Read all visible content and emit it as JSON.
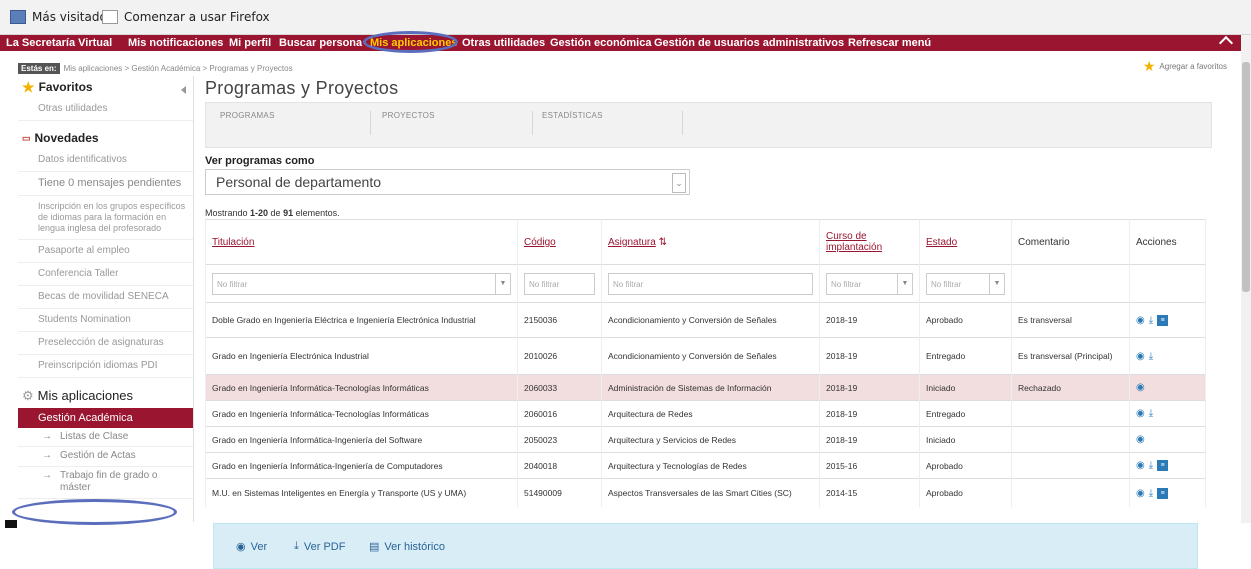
{
  "bookmarks": {
    "item1": "Más visitados",
    "item2": "Comenzar a usar Firefox"
  },
  "nav": {
    "items": [
      "La Secretaría Virtual",
      "Mis notificaciones",
      "Mi perfil",
      "Buscar persona",
      "Mis aplicaciones",
      "Otras utilidades",
      "Gestión económica",
      "Gestión de usuarios administrativos",
      "Refrescar menú"
    ],
    "active": "Mis aplicaciones"
  },
  "breadcrumb": {
    "label": "Estás en:",
    "path": "Mis aplicaciones > Gestión Académica > Programas y Proyectos"
  },
  "favorite_link": "Agregar a favoritos",
  "sidebar": {
    "favoritos_title": "Favoritos",
    "favoritos": [
      "Otras utilidades"
    ],
    "novedades_title": "Novedades",
    "novedades": [
      "Datos identificativos",
      "Tiene 0 mensajes pendientes",
      "Inscripción en los grupos específicos de idiomas para la formación en lengua inglesa del profesorado",
      "Pasaporte al empleo",
      "Conferencia Taller",
      "Becas de movilidad SENECA",
      "Students Nomination",
      "Preselección de asignaturas",
      "Preinscripción idiomas PDI"
    ],
    "apps_title": "Mis aplicaciones",
    "active_app": "Gestión Académica",
    "subitems": [
      "Listas de Clase",
      "Gestión de Actas",
      "Trabajo fin de grado o máster"
    ]
  },
  "page_title": "Programas y Proyectos",
  "tabs": [
    "PROGRAMAS",
    "PROYECTOS",
    "ESTADÍSTICAS"
  ],
  "view_as": {
    "label": "Ver programas como",
    "value": "Personal de departamento"
  },
  "showing": {
    "prefix": "Mostrando ",
    "range": "1-20",
    "middle": " de ",
    "total": "91",
    "suffix": " elementos."
  },
  "table": {
    "headers": {
      "titulacion": "Titulación",
      "codigo": "Código",
      "asignatura": "Asignatura",
      "curso": "Curso de implantación",
      "estado": "Estado",
      "comentario": "Comentario",
      "acciones": "Acciones"
    },
    "filter_placeholder": "No filtrar",
    "rows": [
      {
        "titulacion": "Doble Grado en Ingeniería Eléctrica e Ingeniería Electrónica Industrial",
        "codigo": "2150036",
        "asignatura": "Acondicionamiento y Conversión de Señales",
        "curso": "2018-19",
        "estado": "Aprobado",
        "comentario": "Es transversal",
        "acciones": [
          "view",
          "download",
          "history"
        ]
      },
      {
        "titulacion": "Grado en Ingeniería Electrónica Industrial",
        "codigo": "2010026",
        "asignatura": "Acondicionamiento y Conversión de Señales",
        "curso": "2018-19",
        "estado": "Entregado",
        "comentario": "Es transversal (Principal)",
        "acciones": [
          "view",
          "download"
        ]
      },
      {
        "titulacion": "Grado en Ingeniería Informática-Tecnologías Informáticas",
        "codigo": "2060033",
        "asignatura": "Administración de Sistemas de Información",
        "curso": "2018-19",
        "estado": "Iniciado",
        "comentario": "Rechazado",
        "acciones": [
          "view"
        ],
        "highlight": true
      },
      {
        "titulacion": "Grado en Ingeniería Informática-Tecnologías Informáticas",
        "codigo": "2060016",
        "asignatura": "Arquitectura de Redes",
        "curso": "2018-19",
        "estado": "Entregado",
        "comentario": "",
        "acciones": [
          "view",
          "download"
        ]
      },
      {
        "titulacion": "Grado en Ingeniería Informática-Ingeniería del Software",
        "codigo": "2050023",
        "asignatura": "Arquitectura y Servicios de Redes",
        "curso": "2018-19",
        "estado": "Iniciado",
        "comentario": "",
        "acciones": [
          "view"
        ]
      },
      {
        "titulacion": "Grado en Ingeniería Informática-Ingeniería de Computadores",
        "codigo": "2040018",
        "asignatura": "Arquitectura y Tecnologías de Redes",
        "curso": "2015-16",
        "estado": "Aprobado",
        "comentario": "",
        "acciones": [
          "view",
          "download",
          "history"
        ]
      },
      {
        "titulacion": "M.U. en Sistemas Inteligentes en Energía y Transporte (US y UMA)",
        "codigo": "51490009",
        "asignatura": "Aspectos Transversales de las Smart Cities (SC)",
        "curso": "2014-15",
        "estado": "Aprobado",
        "comentario": "",
        "acciones": [
          "view",
          "download",
          "history"
        ]
      }
    ]
  },
  "footer": {
    "ver": "Ver",
    "ver_pdf": "Ver PDF",
    "ver_historico": "Ver histórico"
  }
}
